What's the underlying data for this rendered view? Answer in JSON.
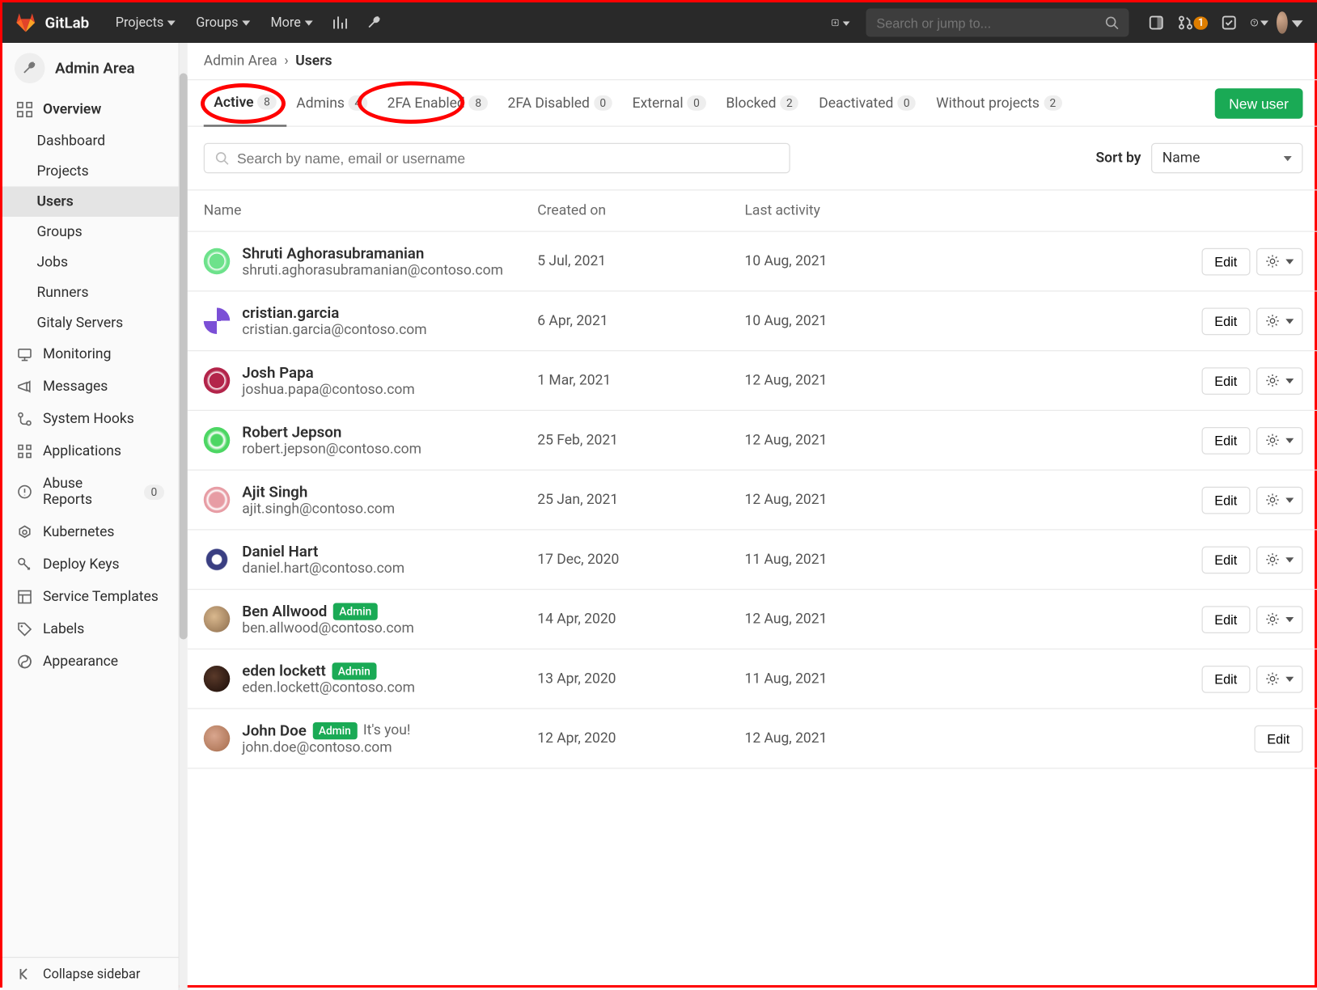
{
  "topbar": {
    "brand": "GitLab",
    "nav": [
      {
        "label": "Projects",
        "caret": true
      },
      {
        "label": "Groups",
        "caret": true
      },
      {
        "label": "More",
        "caret": true
      }
    ],
    "search_placeholder": "Search or jump to...",
    "mr_badge": "1"
  },
  "sidebar": {
    "title": "Admin Area",
    "overview_label": "Overview",
    "overview_items": [
      "Dashboard",
      "Projects",
      "Users",
      "Groups",
      "Jobs",
      "Runners",
      "Gitaly Servers"
    ],
    "active_sub": "Users",
    "items": [
      {
        "icon": "monitor",
        "label": "Monitoring"
      },
      {
        "icon": "megaphone",
        "label": "Messages"
      },
      {
        "icon": "hook",
        "label": "System Hooks"
      },
      {
        "icon": "apps",
        "label": "Applications"
      },
      {
        "icon": "abuse",
        "label": "Abuse Reports",
        "badge": "0"
      },
      {
        "icon": "kube",
        "label": "Kubernetes"
      },
      {
        "icon": "key",
        "label": "Deploy Keys"
      },
      {
        "icon": "template",
        "label": "Service Templates"
      },
      {
        "icon": "tag",
        "label": "Labels"
      },
      {
        "icon": "appearance",
        "label": "Appearance"
      }
    ],
    "collapse_label": "Collapse sidebar"
  },
  "breadcrumb": {
    "parent": "Admin Area",
    "sep": "›",
    "current": "Users"
  },
  "tabs": [
    {
      "label": "Active",
      "count": "8",
      "active": true
    },
    {
      "label": "Admins",
      "count": "4"
    },
    {
      "label": "2FA Enabled",
      "count": "8"
    },
    {
      "label": "2FA Disabled",
      "count": "0"
    },
    {
      "label": "External",
      "count": "0"
    },
    {
      "label": "Blocked",
      "count": "2"
    },
    {
      "label": "Deactivated",
      "count": "0"
    },
    {
      "label": "Without projects",
      "count": "2"
    }
  ],
  "new_user_label": "New user",
  "filter": {
    "placeholder": "Search by name, email or username",
    "sort_label": "Sort by",
    "sort_value": "Name"
  },
  "columns": {
    "name": "Name",
    "created": "Created on",
    "activity": "Last activity"
  },
  "users": [
    {
      "name": "Shruti Aghorasubramanian",
      "email": "shruti.aghorasubramanian@contoso.com",
      "created": "5 Jul, 2021",
      "activity": "10 Aug, 2021",
      "admin": false,
      "avatar_bg": "radial-gradient(circle,#6de28b 40%,#fff 42%,#6de28b 55%)",
      "edit": "Edit",
      "menu": true
    },
    {
      "name": "cristian.garcia",
      "email": "cristian.garcia@contoso.com",
      "created": "6 Apr, 2021",
      "activity": "10 Aug, 2021",
      "admin": false,
      "avatar_bg": "conic-gradient(#7b4fd6 0 25%,#fff 0 50%,#7b4fd6 0 75%,#fff 0)",
      "edit": "Edit",
      "menu": true
    },
    {
      "name": "Josh Papa",
      "email": "joshua.papa@contoso.com",
      "created": "1 Mar, 2021",
      "activity": "12 Aug, 2021",
      "admin": false,
      "avatar_bg": "radial-gradient(circle,#b3244a 40%,#fff 42%,#b3244a 55%)",
      "edit": "Edit",
      "menu": true
    },
    {
      "name": "Robert Jepson",
      "email": "robert.jepson@contoso.com",
      "created": "25 Feb, 2021",
      "activity": "12 Aug, 2021",
      "admin": false,
      "avatar_bg": "radial-gradient(circle,#4cd663 30%,#fff 40%,#4cd663 55%)",
      "edit": "Edit",
      "menu": true
    },
    {
      "name": "Ajit Singh",
      "email": "ajit.singh@contoso.com",
      "created": "25 Jan, 2021",
      "activity": "12 Aug, 2021",
      "admin": false,
      "avatar_bg": "radial-gradient(circle,#e79ca4 40%,#fff 50%,#e79ca4 60%)",
      "edit": "Edit",
      "menu": true
    },
    {
      "name": "Daniel Hart",
      "email": "daniel.hart@contoso.com",
      "created": "17 Dec, 2020",
      "activity": "11 Aug, 2021",
      "admin": false,
      "avatar_bg": "radial-gradient(circle,#fff 25%,#3a3f82 30% 55%,#fff 60%)",
      "edit": "Edit",
      "menu": true
    },
    {
      "name": "Ben Allwood",
      "email": "ben.allwood@contoso.com",
      "created": "14 Apr, 2020",
      "activity": "12 Aug, 2021",
      "admin": true,
      "avatar_bg": "radial-gradient(circle at 40% 40%,#d9b88e,#8a6a4a)",
      "edit": "Edit",
      "menu": true
    },
    {
      "name": "eden lockett",
      "email": "eden.lockett@contoso.com",
      "created": "13 Apr, 2020",
      "activity": "11 Aug, 2021",
      "admin": true,
      "avatar_bg": "radial-gradient(circle at 40% 40%,#5a3a2a,#1a0c08)",
      "edit": "Edit",
      "menu": true
    },
    {
      "name": "John Doe",
      "email": "john.doe@contoso.com",
      "created": "12 Apr, 2020",
      "activity": "12 Aug, 2021",
      "admin": true,
      "you": "It's you!",
      "avatar_bg": "radial-gradient(circle at 40% 40%,#d9a68e,#a46a4a)",
      "edit": "Edit",
      "menu": false
    }
  ],
  "admin_badge_text": "Admin"
}
